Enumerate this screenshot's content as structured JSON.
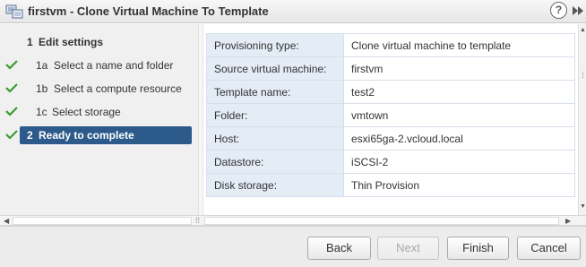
{
  "window": {
    "title": "firstvm - Clone Virtual Machine To Template",
    "help_symbol": "?"
  },
  "steps": [
    {
      "num": "1",
      "label": "Edit settings",
      "done": false,
      "kind": "header"
    },
    {
      "num": "1a",
      "label": "Select a name and folder",
      "done": true,
      "kind": "sub"
    },
    {
      "num": "1b",
      "label": "Select a compute resource",
      "done": true,
      "kind": "sub"
    },
    {
      "num": "1c",
      "label": "Select storage",
      "done": true,
      "kind": "sub"
    },
    {
      "num": "2",
      "label": "Ready to complete",
      "done": true,
      "kind": "active"
    }
  ],
  "summary": [
    {
      "key": "Provisioning type:",
      "value": "Clone virtual machine to template"
    },
    {
      "key": "Source virtual machine:",
      "value": "firstvm"
    },
    {
      "key": "Template name:",
      "value": "test2"
    },
    {
      "key": "Folder:",
      "value": "vmtown"
    },
    {
      "key": "Host:",
      "value": "esxi65ga-2.vcloud.local"
    },
    {
      "key": "Datastore:",
      "value": "iSCSI-2"
    },
    {
      "key": "Disk storage:",
      "value": "Thin Provision"
    }
  ],
  "buttons": {
    "back": "Back",
    "next": "Next",
    "finish": "Finish",
    "cancel": "Cancel"
  },
  "colors": {
    "check": "#3a9a2f",
    "active_step": "#2c5a8a",
    "key_cell": "#e4ecf6"
  }
}
